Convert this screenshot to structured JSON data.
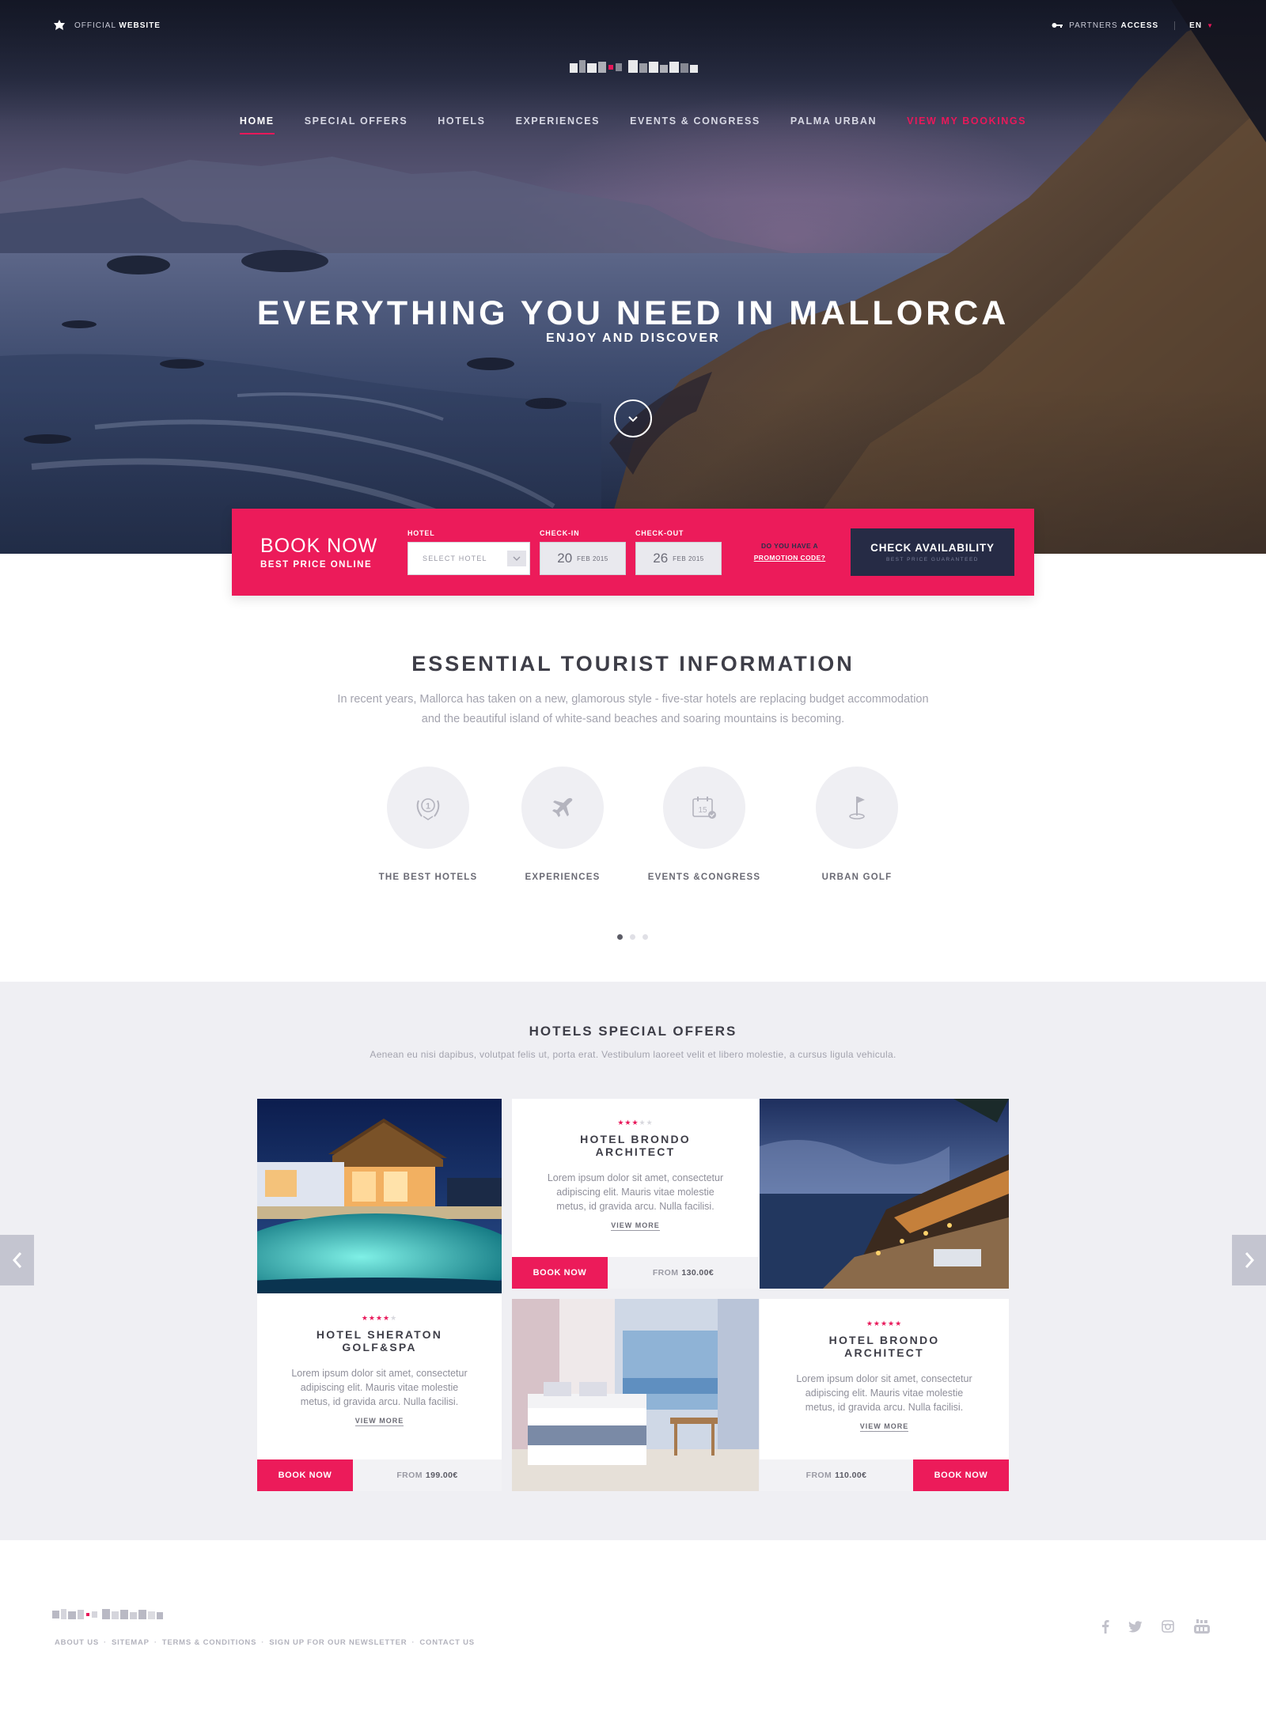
{
  "topbar": {
    "official_prefix": "OFFICIAL",
    "official_bold": "WEBSITE",
    "partners_prefix": "PARTNERS",
    "partners_bold": "ACCESS",
    "language": "EN"
  },
  "nav": {
    "items": [
      {
        "label": "HOME",
        "active": true
      },
      {
        "label": "SPECIAL OFFERS"
      },
      {
        "label": "HOTELS"
      },
      {
        "label": "EXPERIENCES"
      },
      {
        "label": "EVENTS & CONGRESS"
      },
      {
        "label": "PALMA URBAN"
      },
      {
        "label": "VIEW MY BOOKINGS",
        "highlight": true
      }
    ]
  },
  "hero": {
    "title": "EVERYTHING YOU NEED IN MALLORCA",
    "subtitle": "ENJOY AND  DISCOVER"
  },
  "booking": {
    "title": "BOOK NOW",
    "subtitle": "BEST PRICE ONLINE",
    "hotel_label": "HOTEL",
    "hotel_placeholder": "SELECT HOTEL",
    "checkin_label": "CHECK-IN",
    "checkin_day": "20",
    "checkin_month": "FEB 2015",
    "checkout_label": "CHECK-OUT",
    "checkout_day": "26",
    "checkout_month": "FEB 2015",
    "promo_line1": "DO YOU HAVE A",
    "promo_line2": "PROMOTION CODE?",
    "check_label": "CHECK AVAILABILITY",
    "check_sub": "BEST PRICE GUARANTEED"
  },
  "essential": {
    "title": "ESSENTIAL TOURIST INFORMATION",
    "line1": "In recent years, Mallorca has taken on a new, glamorous style - five-star hotels are replacing budget accommodation",
    "line2": "and the beautiful island of white-sand beaches and soaring mountains is becoming.",
    "features": [
      {
        "label": "THE BEST HOTELS",
        "icon": "laurel-medal-icon"
      },
      {
        "label": "EXPERIENCES",
        "icon": "airplane-icon"
      },
      {
        "label": "EVENTS &CONGRESS",
        "icon": "calendar-icon",
        "icon_text": "15"
      },
      {
        "label": "URBAN GOLF",
        "icon": "golf-flag-icon"
      }
    ],
    "carousel_active_index": 0,
    "carousel_count": 3
  },
  "offers": {
    "title": "HOTELS SPECIAL OFFERS",
    "description": "Aenean eu nisi dapibus, volutpat felis ut, porta erat. Vestibulum laoreet velit et libero molestie, a cursus ligula vehicula.",
    "cards": [
      {
        "name_line1": "HOTEL BRONDO",
        "name_line2": "ARCHITECT",
        "stars": 3,
        "text": "Lorem ipsum dolor sit amet, consectetur adipiscing elit. Mauris vitae molestie metus, id gravida arcu. Nulla facilisi.",
        "more": "VIEW MORE",
        "book": "BOOK NOW",
        "from_label": "FROM",
        "price": "130.00€"
      },
      {
        "name_line1": "HOTEL SHERATON",
        "name_line2": "GOLF&SPA",
        "stars": 4,
        "text": "Lorem ipsum dolor sit amet, consectetur adipiscing elit. Mauris vitae molestie metus, id gravida arcu. Nulla facilisi.",
        "more": "VIEW MORE",
        "book": "BOOK NOW",
        "from_label": "FROM",
        "price": "199.00€"
      },
      {
        "name_line1": "HOTEL BRONDO",
        "name_line2": "ARCHITECT",
        "stars": 5,
        "text": "Lorem ipsum dolor sit amet, consectetur adipiscing elit. Mauris vitae molestie metus, id gravida arcu. Nulla facilisi.",
        "more": "VIEW MORE",
        "book": "BOOK NOW",
        "from_label": "FROM",
        "price": "110.00€"
      }
    ]
  },
  "footer": {
    "links": [
      "ABOUT US",
      "SITEMAP",
      "TERMS & CONDITIONS",
      "SIGN UP FOR OUR NEWSLETTER",
      "CONTACT US"
    ],
    "separator": "·",
    "social_icons": [
      "facebook-icon",
      "twitter-icon",
      "instagram-icon",
      "youtube-icon"
    ]
  },
  "colors": {
    "accent": "#ec1b5a",
    "navy": "#262b45",
    "offers_bg": "#efeff3"
  }
}
